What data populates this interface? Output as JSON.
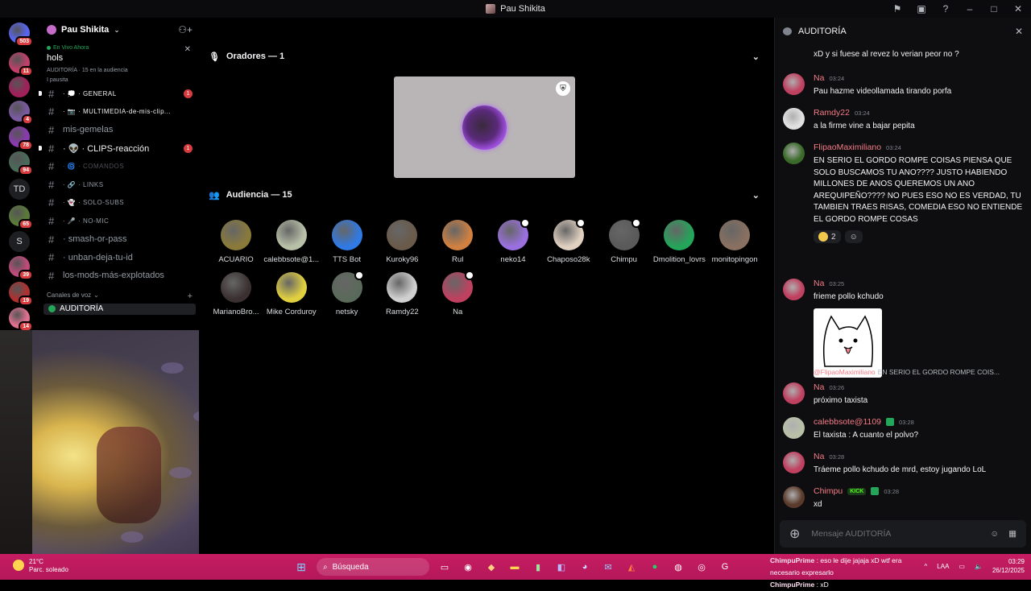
{
  "window": {
    "title": "Pau Shikita"
  },
  "servers": [
    {
      "badge": "503",
      "color": "#5865f2",
      "kind": "dm"
    },
    {
      "badge": "11",
      "color": "#c0406a"
    },
    {
      "badge": "",
      "color": "#a0205a"
    },
    {
      "badge": "4",
      "color": "#7a5aa0"
    },
    {
      "badge": "78",
      "color": "#8a3ab0"
    },
    {
      "badge": "94",
      "color": "#4a6a5a"
    },
    {
      "text": "TD"
    },
    {
      "badge": "65",
      "color": "#5a7a3a"
    },
    {
      "text": "S"
    },
    {
      "badge": "39",
      "color": "#c04a7a"
    },
    {
      "badge": "19",
      "color": "#b03030"
    },
    {
      "badge": "14",
      "color": "#e07090"
    }
  ],
  "guild": {
    "name": "Pau Shikita",
    "live_label": "En Vivo Ahora",
    "live_title": "hols",
    "live_meta": "AUDITORÍA  ·  15 en la audiencia",
    "live_host": "I pausita"
  },
  "channels": [
    {
      "name": "· 💭 · GENERAL",
      "style": "small bright",
      "unread": "1",
      "pip": true
    },
    {
      "name": "· 📷 · MULTIMEDIA-de-mis-clip...",
      "style": "small bright"
    },
    {
      "name": "mis-gemelas",
      "style": ""
    },
    {
      "name": "· 👽 · CLIPS-reacción",
      "style": "bright",
      "unread": "1",
      "pip": true
    },
    {
      "name": "· 🌀 · COMANDOS",
      "style": "small dim"
    },
    {
      "name": "· 🔗 · LINKS",
      "style": "small"
    },
    {
      "name": "· 👻 · SOLO-SUBS",
      "style": "small"
    },
    {
      "name": "· 🎤 · NO-MIC",
      "style": "small"
    },
    {
      "name": "· smash-or-pass",
      "style": ""
    },
    {
      "name": "· unban-deja-tu-id",
      "style": ""
    },
    {
      "name": "los-mods-más-explotados",
      "style": ""
    }
  ],
  "voice": {
    "header": "Canales de voz",
    "channel": "AUDITORÍA"
  },
  "stage": {
    "speakers_label": "Oradores — 1",
    "audience_label": "Audiencia — 15",
    "audience": [
      {
        "name": "ACUARIO",
        "color": "#8a7a3a",
        "mod": false
      },
      {
        "name": "calebbsote@1...",
        "color": "#b8c0a8",
        "mod": false
      },
      {
        "name": "TTS Bot",
        "color": "#2f7ae5",
        "mod": false
      },
      {
        "name": "Kuroky96",
        "color": "#6a5a4a",
        "mod": false
      },
      {
        "name": "Rul",
        "color": "#d08040",
        "mod": false
      },
      {
        "name": "neko14",
        "color": "#9a70e0",
        "mod": true
      },
      {
        "name": "Chaposo28k",
        "color": "#e0d0c0",
        "mod": true
      },
      {
        "name": "Chimpu",
        "color": "#5a5a5a",
        "mod": true
      },
      {
        "name": "Dmolition_lovrs",
        "color": "#23a55a",
        "mod": false
      },
      {
        "name": "monitopingon",
        "color": "#8a7060",
        "mod": false
      },
      {
        "name": "MarianoBro...",
        "color": "#3a3030",
        "mod": false
      },
      {
        "name": "Mike Corduroy",
        "color": "#e0d040",
        "mod": false
      },
      {
        "name": "netsky",
        "color": "#5a6a5a",
        "mod": true
      },
      {
        "name": "Ramdy22",
        "color": "#d0d0d0",
        "mod": false
      },
      {
        "name": "Na",
        "color": "#c04060",
        "mod": true
      }
    ]
  },
  "chat": {
    "title": "AUDITORÍA",
    "placeholder": "Mensaje AUDITORÍA",
    "top_line": "xD y si fuese al revez lo verian peor no ?",
    "messages": [
      {
        "author": "Na",
        "time": "03:24",
        "body": "Pau hazme videollamada tirando porfa",
        "color": "#f47b86"
      },
      {
        "author": "Ramdy22",
        "time": "03:24",
        "body": "a la firme vine a bajar pepita",
        "color": "#f47b86"
      },
      {
        "author": "FlipaoMaximiliano",
        "time": "03:24",
        "body": "EN SERIO EL GORDO ROMPE COISAS PIENSA QUE SOLO BUSCAMOS TU ANO???? JUSTO HABIENDO MILLONES DE ANOS QUEREMOS UN ANO AREQUIPEÑO???? NO PUES ESO NO ES VERDAD, TU TAMBIEN TRAES RISAS, COMEDIA ESO NO ENTIENDE EL GORDO ROMPE COSAS",
        "color": "#f47b86",
        "reaction_count": "2"
      },
      {
        "author": "Na",
        "time": "03:25",
        "body": "frieme pollo kchudo",
        "color": "#f47b86"
      },
      {
        "reply_author": "@FlipaoMaximiliano",
        "reply_text": "EN SERIO EL GORDO ROMPE COIS...",
        "author": "Na",
        "time": "03:26",
        "body": "próximo taxista",
        "color": "#f47b86"
      },
      {
        "author": "calebbsote@1109",
        "time": "03:28",
        "body": "El taxista : A cuanto el polvo?",
        "color": "#f47b86"
      },
      {
        "author": "Na",
        "time": "03:28",
        "body": "Tráeme pollo kchudo de mrd, estoy jugando LoL",
        "color": "#f47b86"
      },
      {
        "author": "Chimpu",
        "time": "03:28",
        "body": "xd",
        "color": "#f47b86",
        "tag": "KICK"
      }
    ]
  },
  "taskbar": {
    "temp": "21°C",
    "weather": "Parc. soleado",
    "search": "Búsqueda",
    "ticker": [
      {
        "user": "ChimpuPrime",
        "text": " : eso le dije jajaja xD wtf era necesario expresarlo"
      },
      {
        "user": "ChimpuPrime",
        "text": " : xD"
      }
    ],
    "lang": "LAA",
    "time": "03:29",
    "date": "26/12/2025"
  }
}
